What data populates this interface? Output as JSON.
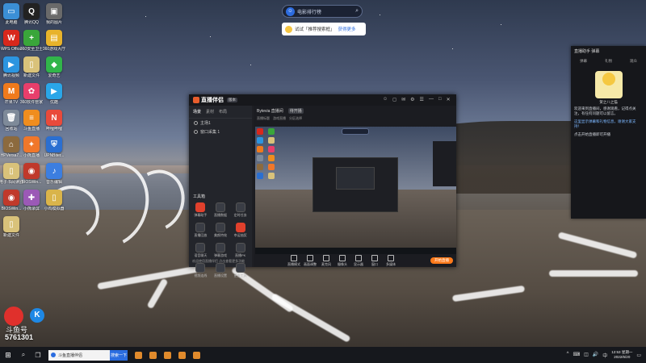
{
  "desktop": {
    "icons": [
      {
        "label": "此电脑",
        "color": "#3b8fd6",
        "glyph": "▭"
      },
      {
        "label": "腾讯QQ",
        "color": "#222222",
        "glyph": "Q"
      },
      {
        "label": "我的图片",
        "color": "#6a6a6a",
        "glyph": "▣"
      },
      {
        "label": "WPS Office",
        "color": "#d8281c",
        "glyph": "W"
      },
      {
        "label": "360安全卫士",
        "color": "#3aa63a",
        "glyph": "+"
      },
      {
        "label": "360游戏大厅",
        "color": "#e8b32b",
        "glyph": "▤"
      },
      {
        "label": "腾讯视频",
        "color": "#2c95e0",
        "glyph": "▶"
      },
      {
        "label": "新建文件",
        "color": "#d9c27a",
        "glyph": "▯"
      },
      {
        "label": "爱奇艺",
        "color": "#31b54a",
        "glyph": "◆"
      },
      {
        "label": "芒果TV",
        "color": "#f07a1c",
        "glyph": "M"
      },
      {
        "label": "360软件管家",
        "color": "#e83e6b",
        "glyph": "✿"
      },
      {
        "label": "优酷",
        "color": "#2aa6e8",
        "glyph": "▶"
      },
      {
        "label": "回收站",
        "color": "#7e8a99",
        "glyph": "🗑"
      },
      {
        "label": "斗鱼直播",
        "color": "#f08d1e",
        "glyph": "≡"
      },
      {
        "label": "哔哩哔哩",
        "color": "#e94a3b",
        "glyph": "N"
      },
      {
        "label": "HPVersa7...",
        "color": "#8c6a3e",
        "glyph": "⌂"
      },
      {
        "label": "小熊直播",
        "color": "#f0772a",
        "glyph": "✦"
      },
      {
        "label": "UPNBiter...",
        "color": "#2b6fd1",
        "glyph": "⛨"
      },
      {
        "label": "电子书阅读器",
        "color": "#d9c27a",
        "glyph": "▯"
      },
      {
        "label": "BIOSWin...",
        "color": "#c0392b",
        "glyph": "◉"
      },
      {
        "label": "音乐编辑",
        "color": "#3c7ee0",
        "glyph": "♪"
      },
      {
        "label": "BIOSWin...",
        "color": "#c0392b",
        "glyph": "◉"
      },
      {
        "label": "小熊录屏",
        "color": "#9b59b6",
        "glyph": "✚"
      },
      {
        "label": "小鸡模拟器",
        "color": "#d9b44a",
        "glyph": "▯"
      },
      {
        "label": "新建文件",
        "color": "#d9c27a",
        "glyph": "▯"
      }
    ]
  },
  "search_bar": {
    "text": "电影排行榜",
    "logo_glyph": "☺"
  },
  "tip": {
    "text": "试试「推荐搜索框」",
    "link": "获得更多"
  },
  "app": {
    "brand": "直播伴侣",
    "badge": "版本",
    "left_tabs": [
      "场景",
      "素材",
      "布局"
    ],
    "scenes": [
      "主场1",
      "窗口采集 1"
    ],
    "tools_title": "工具箱",
    "tools": [
      {
        "label": "弹幕助手",
        "red": true
      },
      {
        "label": "直播数据",
        "red": false
      },
      {
        "label": "定时任务",
        "red": false
      },
      {
        "label": "直播回放",
        "red": false
      },
      {
        "label": "美颜特效",
        "red": false
      },
      {
        "label": "幸运抽奖",
        "red": true
      },
      {
        "label": "语音聊天",
        "red": false
      },
      {
        "label": "弹幕游戏",
        "red": false
      },
      {
        "label": "直播PK",
        "red": false
      },
      {
        "label": "视频连线",
        "red": false
      },
      {
        "label": "直播设置",
        "red": false
      },
      {
        "label": "更多工具",
        "red": false
      }
    ],
    "left_footer": "欢迎使用直播伴侣  点击查看更多功能",
    "right_header": {
      "title": "Bytevia 直播间",
      "tag": "待开播",
      "sub": [
        "直播标题",
        "游戏直播",
        "分区选择"
      ]
    },
    "bottom_tools": [
      "直播模式",
      "画面调整",
      "麦克风",
      "摄像头",
      "显示器",
      "窗口",
      "多媒体"
    ],
    "live_button": "开始直播",
    "window_controls": [
      "☺",
      "◻",
      "✉",
      "⚙",
      "☰",
      "—",
      "□",
      "✕"
    ]
  },
  "chat": {
    "title": "直播助手 弹幕",
    "tabs": [
      "弹幕",
      "礼物",
      "观众"
    ],
    "avatar_caption": "贺之八之猫",
    "messages": [
      {
        "text": "欢迎来到直播间，感谢观看，记得点关注，有任何问题可以留言。",
        "blue": false
      },
      {
        "text": "这里显示弹幕和礼物信息，谢谢大家支持！",
        "blue": true
      },
      {
        "text": "点击开始直播即可开播",
        "blue": false
      }
    ]
  },
  "watermark": {
    "name": "斗鱼号",
    "number": "5761301",
    "k_glyph": "K"
  },
  "taskbar": {
    "search_text": "斗鱼直播伴侣",
    "search_button": "搜索一下",
    "apps": [
      "#e08a2c",
      "#e08a2c",
      "#e08a2c",
      "#e08a2c",
      "#e08a2c"
    ],
    "tray": [
      "^",
      "⌨",
      "◫",
      "🔊",
      "中"
    ],
    "time": "12:53",
    "day": "星期一",
    "date": "2022/6/20"
  }
}
